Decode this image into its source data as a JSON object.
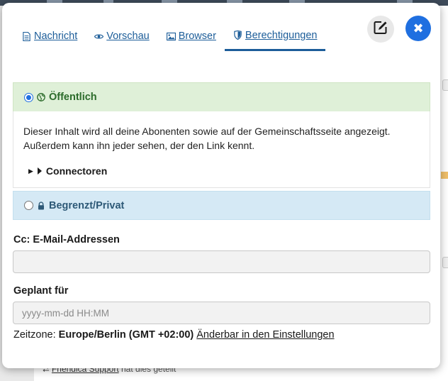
{
  "background": {
    "bottom_prefix": "⮂",
    "bottom_link": "Friendica Support",
    "bottom_suffix": " hat dies geteilt"
  },
  "tabs": [
    {
      "label": "Nachricht",
      "icon": "file-text-icon"
    },
    {
      "label": "Vorschau",
      "icon": "eye-icon"
    },
    {
      "label": "Browser",
      "icon": "image-icon"
    },
    {
      "label": "Berechtigungen",
      "icon": "shield-icon",
      "active": true
    }
  ],
  "buttons": {
    "edit_icon": "edit-icon",
    "close_glyph": "✖"
  },
  "public": {
    "title": "Öffentlich",
    "selected": true,
    "description": "Dieser Inhalt wird all deine Abonenten sowie auf der Gemeinschaftsseite angezeigt. Außerdem kann ihn jeder sehen, der den Link kennt.",
    "connectors_label": "Connectoren"
  },
  "private": {
    "title": "Begrenzt/Privat",
    "selected": false
  },
  "cc": {
    "label": "Cc: E-Mail-Addressen",
    "value": "",
    "placeholder": ""
  },
  "schedule": {
    "label": "Geplant für",
    "value": "",
    "placeholder": "yyyy-mm-dd HH:MM"
  },
  "timezone": {
    "prefix": "Zeitzone: ",
    "value": "Europe/Berlin (GMT +02:00)",
    "link": "Änderbar in den Einstellungen"
  },
  "colors": {
    "accent": "#1f6fe0",
    "tab_link": "#1c5d99",
    "public_bg": "#dff0d8",
    "public_text": "#2b6b2a",
    "private_bg": "#d5e9f5",
    "private_text": "#2d5977"
  }
}
